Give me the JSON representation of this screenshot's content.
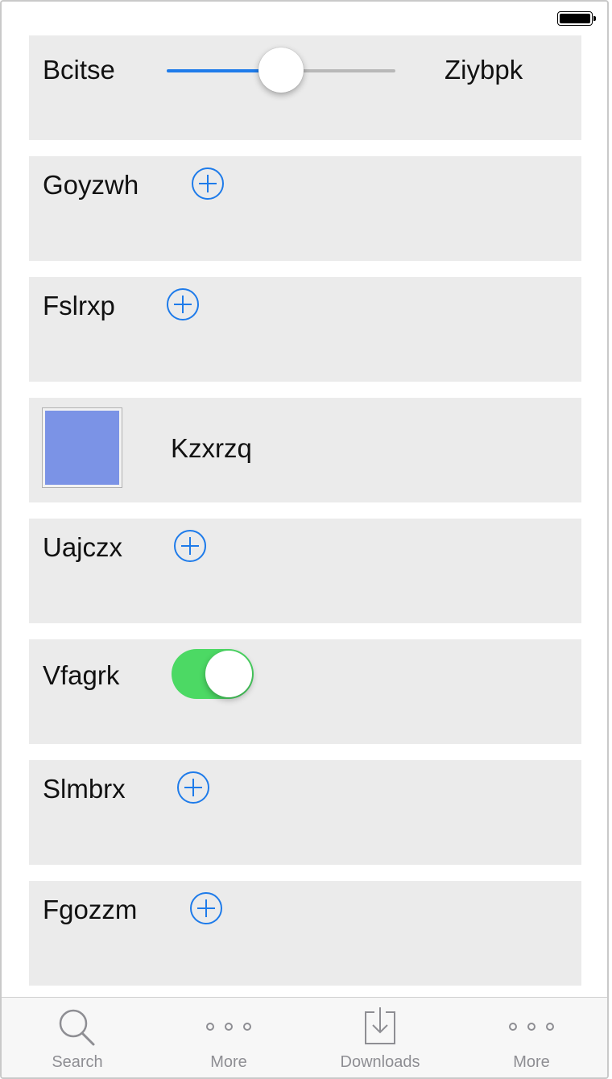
{
  "status_bar": {
    "battery_icon": "battery-full-icon"
  },
  "rows": {
    "slider_row": {
      "min_label": "Bcitse",
      "max_label": "Ziybpk",
      "value_fraction": 0.5
    },
    "row_goyzwh": {
      "label": "Goyzwh",
      "icon": "add-circle-icon"
    },
    "row_fslrxp": {
      "label": "Fslrxp",
      "icon": "add-circle-icon"
    },
    "color_row": {
      "label": "Kzxrzq",
      "swatch_color": "#7b93e6"
    },
    "row_uajczx": {
      "label": "Uajczx",
      "icon": "add-circle-icon"
    },
    "toggle_row": {
      "label": "Vfagrk",
      "on": true,
      "on_color": "#4cd964"
    },
    "row_slmbrx": {
      "label": "Slmbrx",
      "icon": "add-circle-icon"
    },
    "row_fgozzm": {
      "label": "Fgozzm",
      "icon": "add-circle-icon"
    }
  },
  "tabbar": {
    "tabs": [
      {
        "label": "Search",
        "icon": "search-icon"
      },
      {
        "label": "More",
        "icon": "more-icon"
      },
      {
        "label": "Downloads",
        "icon": "download-icon"
      },
      {
        "label": "More",
        "icon": "more-icon"
      }
    ]
  },
  "colors": {
    "accent": "#1e7bea",
    "card_background": "#ebebeb",
    "tab_inactive": "#8e8e93"
  }
}
